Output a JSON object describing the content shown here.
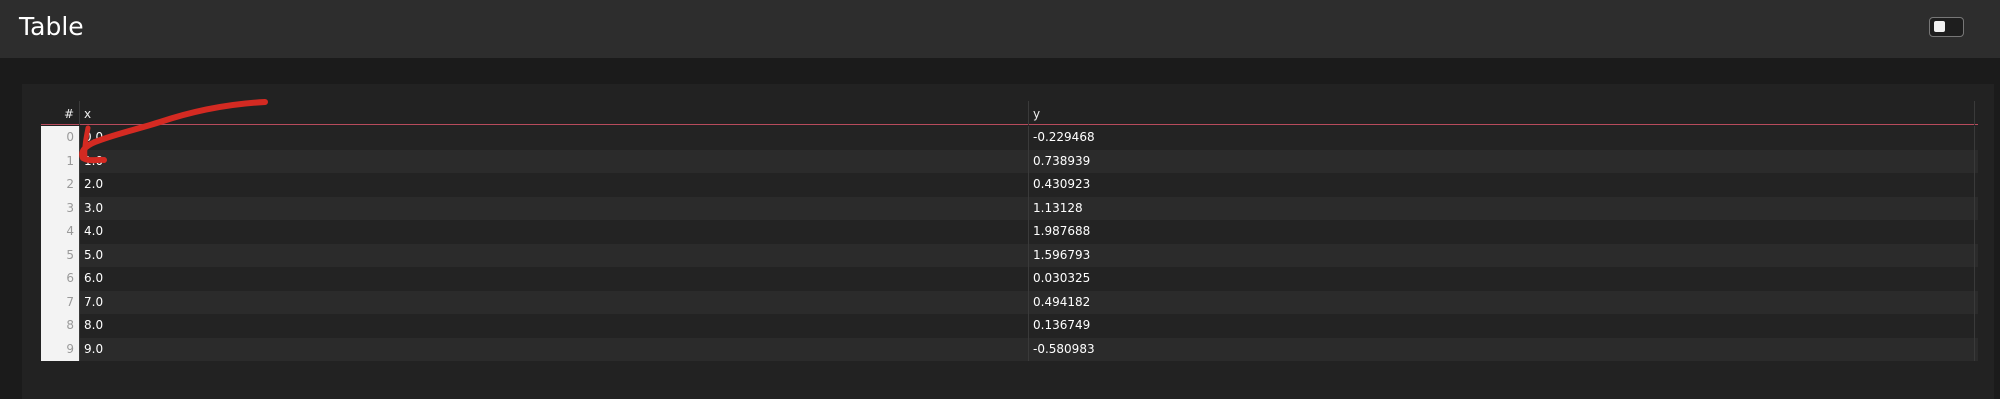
{
  "header": {
    "title": "Table"
  },
  "theme_toggle": {
    "icon": "moon-icon"
  },
  "table": {
    "columns": [
      "#",
      "x",
      "y"
    ],
    "rows": [
      {
        "index": "0",
        "x": "0.0",
        "y": "-0.229468"
      },
      {
        "index": "1",
        "x": "1.0",
        "y": "0.738939"
      },
      {
        "index": "2",
        "x": "2.0",
        "y": "0.430923"
      },
      {
        "index": "3",
        "x": "3.0",
        "y": "1.13128"
      },
      {
        "index": "4",
        "x": "4.0",
        "y": "1.987688"
      },
      {
        "index": "5",
        "x": "5.0",
        "y": "1.596793"
      },
      {
        "index": "6",
        "x": "6.0",
        "y": "0.030325"
      },
      {
        "index": "7",
        "x": "7.0",
        "y": "0.494182"
      },
      {
        "index": "8",
        "x": "8.0",
        "y": "0.136749"
      },
      {
        "index": "9",
        "x": "9.0",
        "y": "-0.580983"
      }
    ]
  },
  "colors": {
    "header_bg": "#2d2d2d",
    "page_bg": "#1b1b1b",
    "panel_bg": "#222222",
    "header_underline": "#b74b5c",
    "annotation_stroke": "#d42a22"
  }
}
